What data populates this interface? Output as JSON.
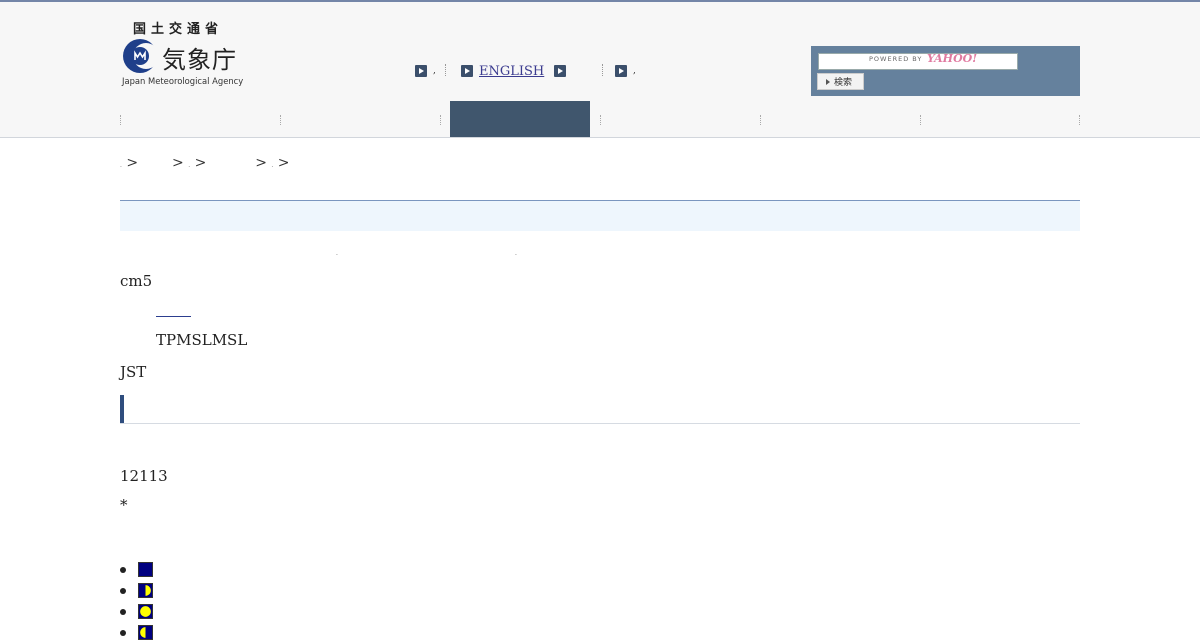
{
  "header": {
    "ministry": "国土交通省",
    "agency_ja": "気象庁",
    "agency_en": "Japan Meteorological Agency",
    "links": [
      {
        "label": ",",
        "icon": "arrow-right-icon"
      },
      {
        "label": "ENGLISH",
        "icon": "arrow-right-icon"
      },
      {
        "label": "",
        "icon": "arrow-right-icon"
      },
      {
        "label": ",",
        "icon": "arrow-right-icon"
      }
    ],
    "search": {
      "powered_by": "POWERED BY",
      "yahoo": "YAHOO!",
      "button": "検索"
    }
  },
  "breadcrumb": {
    "sep": ">"
  },
  "content": {
    "unit": "cm5",
    "datums": "TPMSLMSL",
    "timezone": "JST",
    "count": "12113",
    "note": "*"
  },
  "legend": {
    "items": [
      {
        "name": "new-moon-icon",
        "fill": "#000080"
      },
      {
        "name": "first-quarter-icon",
        "fill": "#ffff00"
      },
      {
        "name": "full-moon-icon",
        "fill": "#ffff00"
      },
      {
        "name": "last-quarter-icon",
        "fill": "#ffff00"
      }
    ]
  },
  "colors": {
    "nav_active": "#40566d",
    "search_bg": "#65819d",
    "accent": "#2f4d7e",
    "title_band": "#eef6fd"
  }
}
